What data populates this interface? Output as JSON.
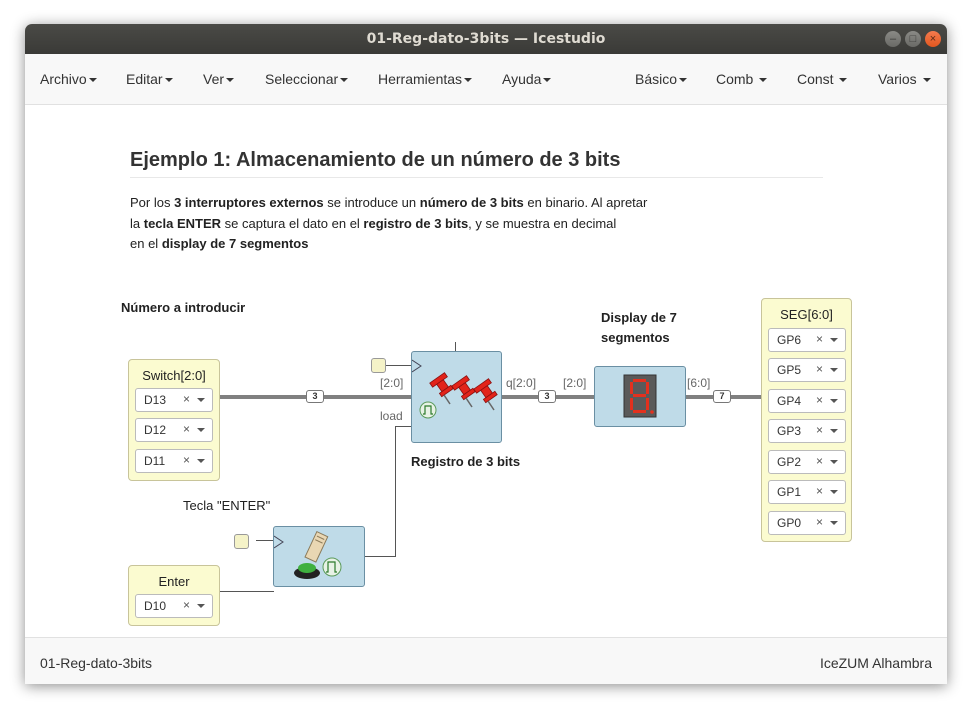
{
  "window": {
    "title": "01-Reg-dato-3bits — Icestudio"
  },
  "menu": {
    "left": [
      "Archivo",
      "Editar",
      "Ver",
      "Seleccionar",
      "Herramientas",
      "Ayuda"
    ],
    "right": [
      "Básico",
      "Comb",
      "Const",
      "Varios"
    ]
  },
  "doc": {
    "title": "Ejemplo 1: Almacenamiento de un número de 3 bits",
    "desc": [
      {
        "t": "Por los ",
        "b": false
      },
      {
        "t": "3 interruptores externos",
        "b": true
      },
      {
        "t": " se introduce un ",
        "b": false
      },
      {
        "t": "número de 3 bits",
        "b": true
      },
      {
        "t": " en binario. Al apretar",
        "b": false
      },
      {
        "br": true
      },
      {
        "t": "la ",
        "b": false
      },
      {
        "t": "tecla ENTER",
        "b": true
      },
      {
        "t": " se captura el dato en el ",
        "b": false
      },
      {
        "t": "registro de 3 bits",
        "b": true
      },
      {
        "t": ", y se muestra en decimal",
        "b": false
      },
      {
        "br": true
      },
      {
        "t": "en el ",
        "b": false
      },
      {
        "t": "display de 7 segmentos",
        "b": true
      }
    ]
  },
  "labels": {
    "numero": "Número a introducir",
    "tecla": "Tecla \"ENTER\"",
    "registro": "Registro de 3 bits",
    "display_l1": "Display de 7",
    "display_l2": "segmentos"
  },
  "switch_port": {
    "name": "Switch[2:0]",
    "pins": [
      "D13",
      "D12",
      "D11"
    ]
  },
  "enter_port": {
    "name": "Enter",
    "pins": [
      "D10"
    ]
  },
  "seg_port": {
    "name": "SEG[6:0]",
    "pins": [
      "GP6",
      "GP5",
      "GP4",
      "GP3",
      "GP2",
      "GP1",
      "GP0"
    ]
  },
  "register": {
    "in_label": "[2:0]",
    "load_label": "load",
    "out_label": "q[2:0]"
  },
  "display": {
    "in_label": "[2:0]",
    "out_label": "[6:0]"
  },
  "badges": {
    "switch_bus": "3",
    "reg_bus": "3",
    "seg_bus": "7"
  },
  "pin_clear": "×",
  "footer": {
    "left": "01-Reg-dato-3bits",
    "right": "IceZUM Alhambra"
  },
  "colors": {
    "port_bg": "#fbfbd0",
    "block_bg": "#bfdbe8",
    "titlebar": "#3c3b37",
    "close_btn": "#e95420"
  }
}
